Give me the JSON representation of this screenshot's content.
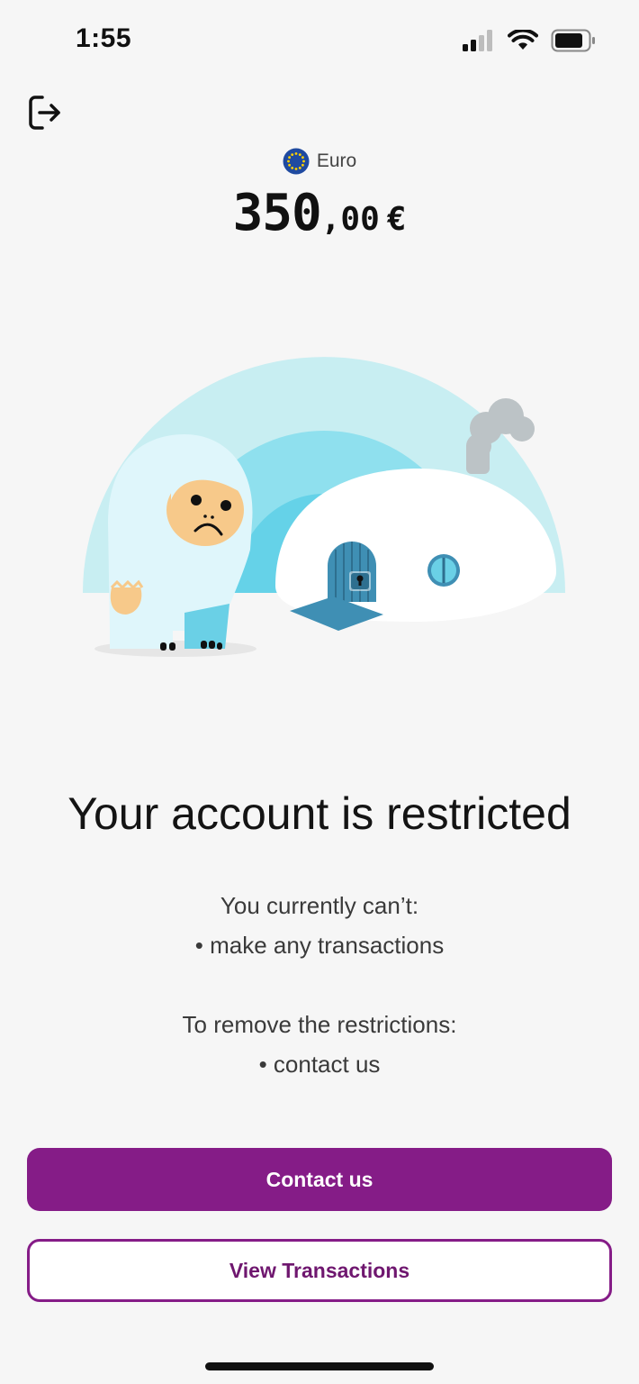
{
  "status_bar": {
    "time": "1:55"
  },
  "currency": {
    "name": "Euro",
    "flag_icon": "eu-flag-icon"
  },
  "balance": {
    "integer": "350",
    "decimals": ",00",
    "symbol": "€"
  },
  "illustration": {
    "name": "sad-yeti-locked-igloo-illustration"
  },
  "title": "Your account is restricted",
  "restrictions": {
    "heading": "You currently can’t:",
    "items": [
      "• make any transactions"
    ]
  },
  "remedy": {
    "heading": "To remove the restrictions:",
    "items": [
      "• contact us"
    ]
  },
  "buttons": {
    "primary": "Contact us",
    "secondary": "View Transactions"
  },
  "colors": {
    "accent": "#851c87",
    "background": "#f6f6f6"
  },
  "icons": {
    "logout": "logout-icon"
  }
}
